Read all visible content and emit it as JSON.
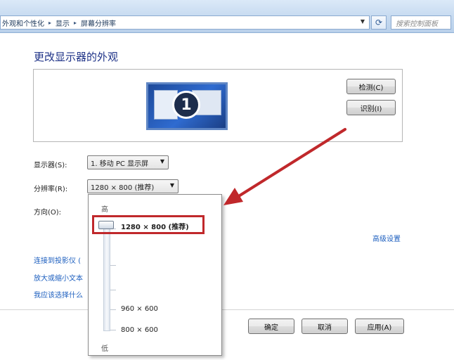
{
  "breadcrumb": {
    "items": [
      "外观和个性化",
      "显示",
      "屏幕分辨率"
    ],
    "separator": "▸"
  },
  "search": {
    "placeholder": "搜索控制面板"
  },
  "page_title": "更改显示器的外观",
  "monitor": {
    "number": "1"
  },
  "buttons": {
    "detect": "检测(C)",
    "identify": "识别(I)",
    "ok": "确定",
    "cancel": "取消",
    "apply": "应用(A)"
  },
  "form": {
    "display_label": "显示器(S):",
    "display_value": "1. 移动 PC 显示屏",
    "resolution_label": "分辨率(R):",
    "resolution_value": "1280 × 800 (推荐)",
    "orientation_label": "方向(O):"
  },
  "advanced_link": "高级设置",
  "links": [
    "连接到投影仪 (",
    "放大或缩小文本",
    "我应该选择什么"
  ],
  "dropdown": {
    "high_label": "高",
    "low_label": "低",
    "current_option": "1280 × 800 (推荐)",
    "option_960": "960 × 600",
    "option_800": "800 × 600"
  },
  "colors": {
    "title": "#1e3287",
    "link": "#1d5fbf",
    "annotation": "#c0282b"
  }
}
